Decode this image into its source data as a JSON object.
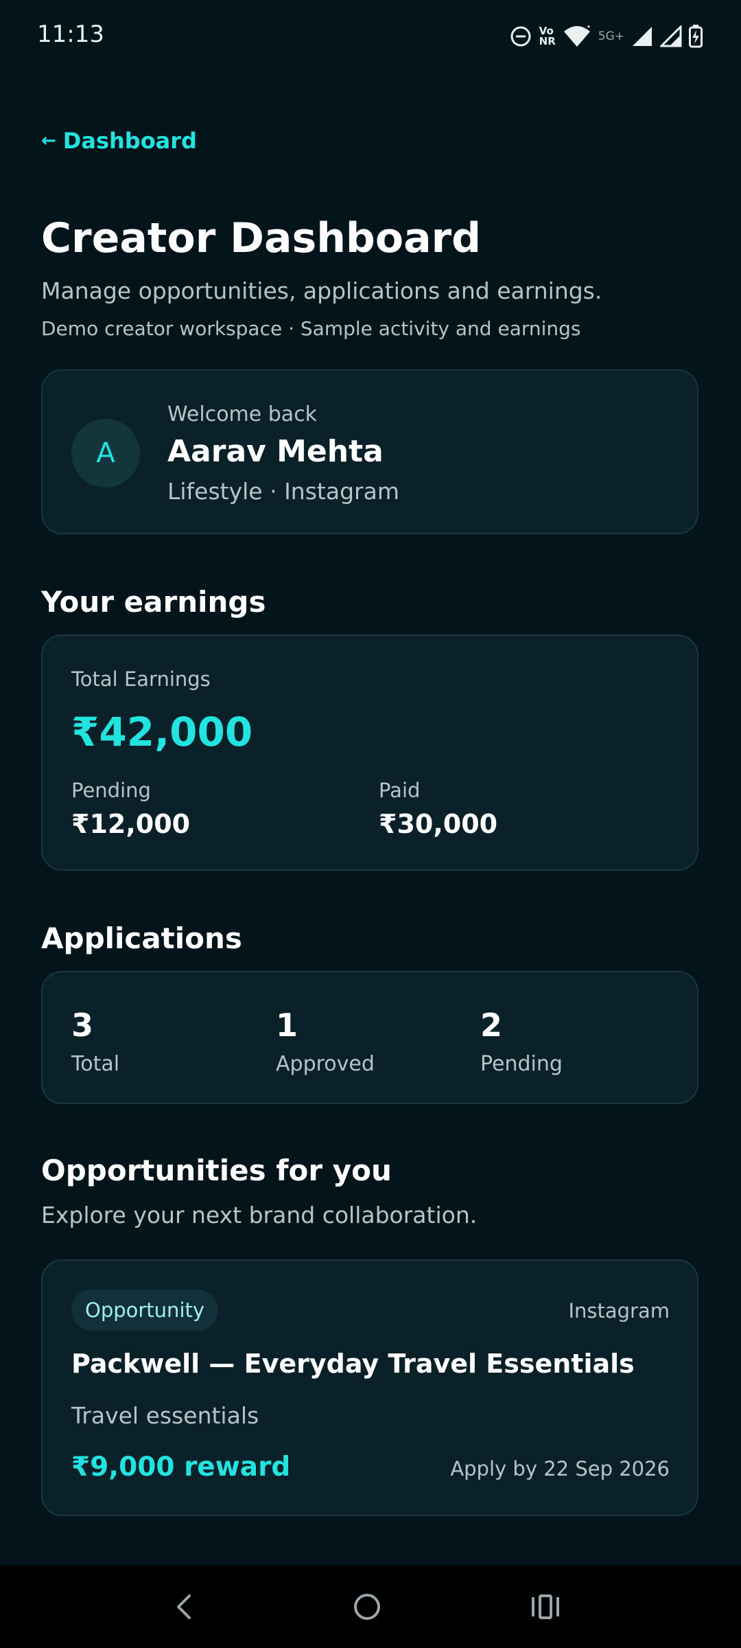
{
  "status_bar": {
    "time": "11:13",
    "volte_label_top": "Vo",
    "volte_label_bottom": "NR",
    "network_label": "5G+"
  },
  "nav": {
    "back_label": "Dashboard",
    "back_arrow": "←"
  },
  "header": {
    "title": "Creator Dashboard",
    "subtitle": "Manage opportunities, applications and earnings.",
    "meta": "Demo creator workspace · Sample activity and earnings"
  },
  "welcome": {
    "avatar_initial": "A",
    "label": "Welcome back",
    "name": "Aarav Mehta",
    "subline": "Lifestyle · Instagram"
  },
  "earnings": {
    "section_title": "Your earnings",
    "total_label": "Total Earnings",
    "total_value": "₹42,000",
    "pending_label": "Pending",
    "pending_value": "₹12,000",
    "paid_label": "Paid",
    "paid_value": "₹30,000"
  },
  "applications": {
    "section_title": "Applications",
    "stats": [
      {
        "value": "3",
        "label": "Total"
      },
      {
        "value": "1",
        "label": "Approved"
      },
      {
        "value": "2",
        "label": "Pending"
      }
    ]
  },
  "opportunities": {
    "section_title": "Opportunities for you",
    "section_subtitle": "Explore your next brand collaboration.",
    "items": [
      {
        "badge": "Opportunity",
        "platform": "Instagram",
        "title": "Packwell — Everyday Travel Essentials",
        "category": "Travel essentials",
        "reward": "₹9,000 reward",
        "deadline": "Apply by 22 Sep 2026"
      }
    ]
  },
  "colors": {
    "background": "#04141b",
    "card": "#0a2129",
    "accent": "#22e3e0",
    "muted_text": "#b9c4c8"
  },
  "icons": {
    "status": [
      "do-not-disturb-icon",
      "volte-icon",
      "wifi-icon",
      "signal-icon",
      "battery-charging-icon"
    ],
    "nav": [
      "back-nav-icon",
      "home-nav-icon",
      "recents-nav-icon"
    ]
  }
}
